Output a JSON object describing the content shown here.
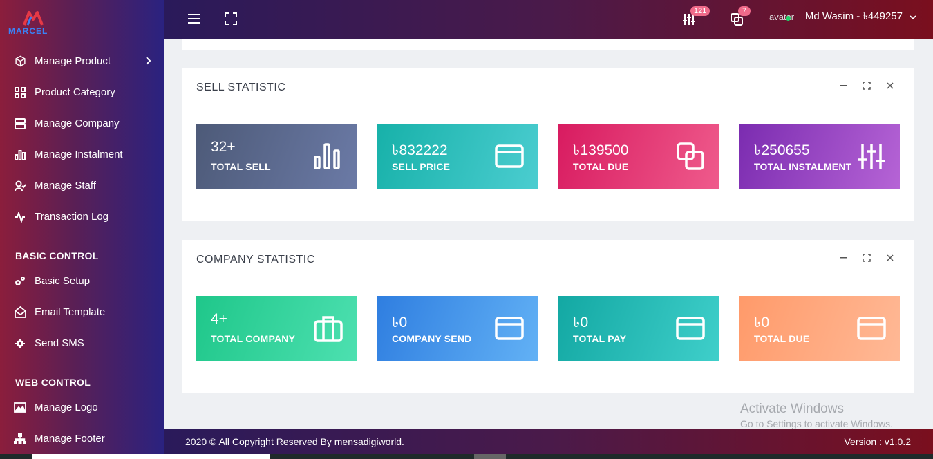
{
  "brand": {
    "logo_text": "MARCEL"
  },
  "sidebar": {
    "items": [
      {
        "label": "Manage Product",
        "icon": "box-icon",
        "has_submenu": true
      },
      {
        "label": "Product Category",
        "icon": "grid-icon"
      },
      {
        "label": "Manage Company",
        "icon": "server-icon"
      },
      {
        "label": "Manage Instalment",
        "icon": "bar-chart-icon"
      },
      {
        "label": "Manage Staff",
        "icon": "user-check-icon"
      },
      {
        "label": "Transaction Log",
        "icon": "activity-icon"
      }
    ],
    "sections": [
      {
        "title": "BASIC CONTROL",
        "items": [
          {
            "label": "Basic Setup",
            "icon": "gears-icon"
          },
          {
            "label": "Email Template",
            "icon": "envelope-open-icon"
          },
          {
            "label": "Send SMS",
            "icon": "gear-icon"
          }
        ]
      },
      {
        "title": "WEB CONTROL",
        "items": [
          {
            "label": "Manage Logo",
            "icon": "image-icon"
          },
          {
            "label": "Manage Footer",
            "icon": "sitemap-icon"
          }
        ]
      }
    ]
  },
  "topbar": {
    "badge_sliders": "121",
    "badge_copies": "7",
    "avatar_alt": "avatar",
    "user_name": "Md Wasim - ৳449257"
  },
  "sell_statistic": {
    "title": "SELL STATISTIC",
    "tiles": [
      {
        "value": "32+",
        "label": "TOTAL SELL",
        "icon": "bar-chart-icon"
      },
      {
        "value": "৳832222",
        "label": "SELL PRICE",
        "icon": "credit-card-icon"
      },
      {
        "value": "৳139500",
        "label": "TOTAL DUE",
        "icon": "copy-icon"
      },
      {
        "value": "৳250655",
        "label": "TOTAL INSTALMENT",
        "icon": "sliders-icon"
      }
    ]
  },
  "company_statistic": {
    "title": "COMPANY STATISTIC",
    "tiles": [
      {
        "value": "4+",
        "label": "TOTAL COMPANY",
        "icon": "briefcase-icon"
      },
      {
        "value": "৳0",
        "label": "COMPANY SEND",
        "icon": "credit-card-icon"
      },
      {
        "value": "৳0",
        "label": "TOTAL PAY",
        "icon": "credit-card-icon"
      },
      {
        "value": "৳0",
        "label": "TOTAL DUE",
        "icon": "credit-card-icon"
      }
    ]
  },
  "footer": {
    "copyright": "2020 © All Copyright Reserved By mensadigiworld.",
    "version": "Version : v1.0.2"
  },
  "watermark": {
    "line1": "Activate Windows",
    "line2": "Go to Settings to activate Windows."
  },
  "colors": {
    "tile_sell": [
      "#4d5a78",
      "#6b7aa6"
    ],
    "tile_price": [
      "#17b1a9",
      "#4bcdd0"
    ],
    "tile_due": [
      "#d81b60",
      "#ef5b8c"
    ],
    "tile_instalment": [
      "#7b2cb0",
      "#b664d6"
    ],
    "tile_company": [
      "#1fc78a",
      "#4de0b0"
    ],
    "tile_send": [
      "#2f7ee0",
      "#62b1f5"
    ],
    "tile_pay": [
      "#13a8a3",
      "#3fcfca"
    ],
    "tile_cdue": [
      "#ff9a6a",
      "#ffb996"
    ]
  }
}
